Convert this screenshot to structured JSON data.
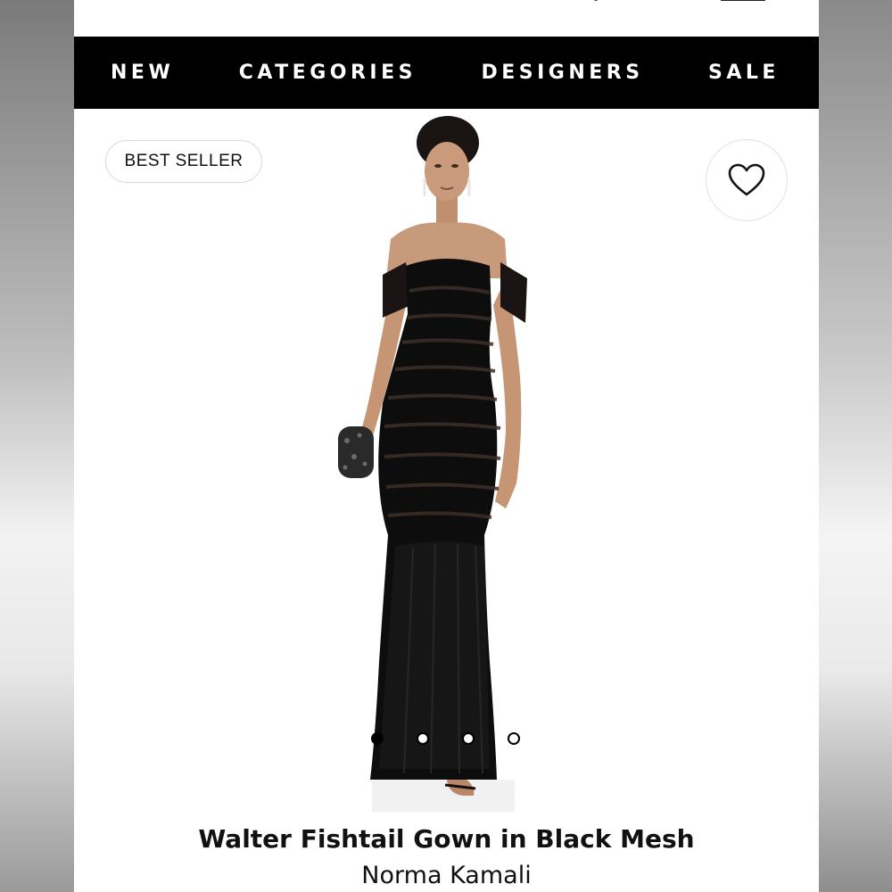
{
  "nav": {
    "items": [
      {
        "label": "NEW"
      },
      {
        "label": "CATEGORIES"
      },
      {
        "label": "DESIGNERS"
      },
      {
        "label": "SALE"
      }
    ]
  },
  "product": {
    "badge": "BEST SELLER",
    "favorite_icon": "heart-outline-icon",
    "carousel": {
      "count": 4,
      "active_index": 0
    },
    "title": "Walter Fishtail Gown in Black Mesh",
    "designer": "Norma Kamali"
  },
  "colors": {
    "nav_background": "#000000",
    "nav_text": "#ffffff",
    "gown": "#0d0d0d",
    "skin": "#c89a7c"
  }
}
